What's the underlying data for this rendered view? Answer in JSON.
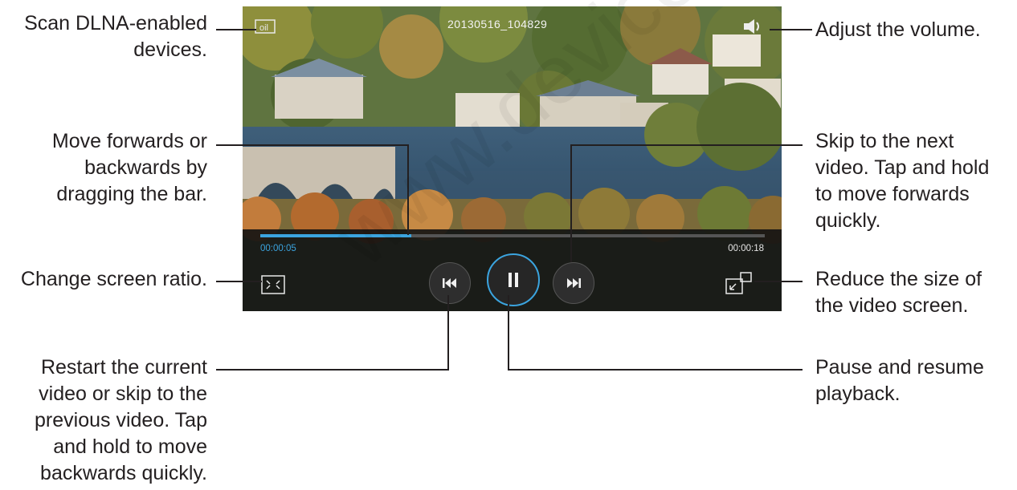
{
  "player": {
    "filename": "20130516_104829",
    "elapsed_time": "00:00:05",
    "total_time": "00:00:18",
    "progress": 0.3,
    "accent_color": "#3ba4df"
  },
  "callouts": {
    "scan_dlna": "Scan DLNA-enabled\ndevices.",
    "move_bar": "Move forwards or\nbackwards by\ndragging the bar.",
    "screen_ratio": "Change screen ratio.",
    "restart": "Restart the current\nvideo or skip to the\nprevious video. Tap\nand hold to move\nbackwards quickly.",
    "volume": "Adjust the volume.",
    "skip_next": "Skip to the next\nvideo. Tap and hold\nto move forwards\nquickly.",
    "reduce_size": "Reduce the size of\nthe video screen.",
    "pause_resume": "Pause and resume\nplayback."
  },
  "icons": {
    "dlna": "dlna-icon",
    "volume": "speaker-icon",
    "ratio": "screen-ratio-icon",
    "previous": "skip-previous-icon",
    "pause": "pause-icon",
    "next": "skip-next-icon",
    "popup": "popup-player-icon"
  },
  "watermark": "www.devicemanuals.eu"
}
